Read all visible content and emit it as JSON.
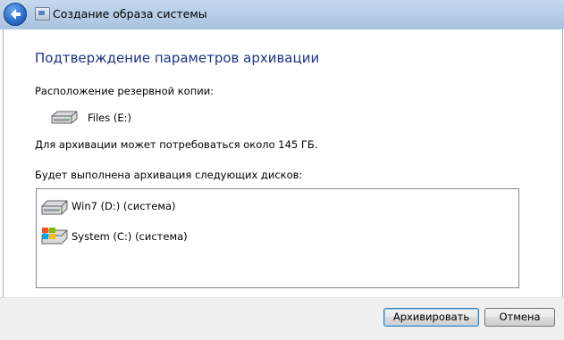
{
  "window": {
    "title": "Создание образа системы"
  },
  "main": {
    "heading": "Подтверждение параметров архивации",
    "location_label": "Расположение резервной копии:",
    "location_drive": "Files (E:)",
    "space_note": "Для архивации может потребоваться около 145 ГБ.",
    "disks_label": "Будет выполнена архивация следующих дисков:",
    "disks": [
      {
        "name": "Win7 (D:) (система)",
        "icon": "hard-drive-icon"
      },
      {
        "name": "System (C:) (система)",
        "icon": "windows-drive-icon"
      }
    ]
  },
  "footer": {
    "archive_button": "Архивировать",
    "cancel_button": "Отмена"
  }
}
